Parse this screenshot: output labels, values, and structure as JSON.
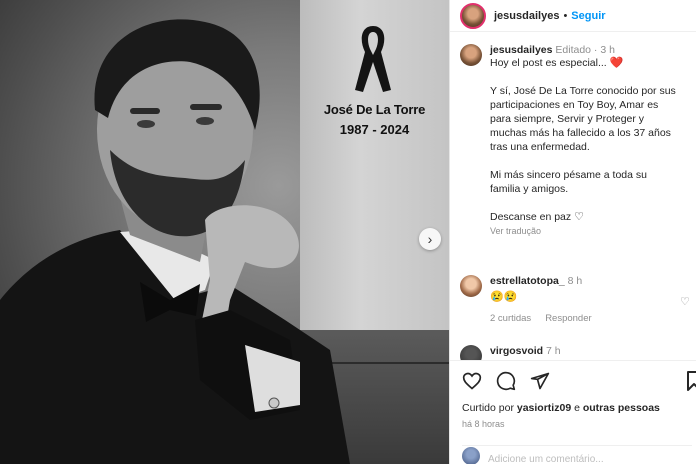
{
  "memorial": {
    "name": "José De La Torre",
    "years": "1987 - 2024"
  },
  "header": {
    "username": "jesusdailyes",
    "separator": "•",
    "follow_label": "Seguir"
  },
  "caption": {
    "username": "jesusdailyes",
    "meta": "Editado · 3 h",
    "lines": [
      "Hoy el post es especial...",
      "Y sí, José De La Torre conocido por sus",
      "participaciones en Toy Boy, Amar es",
      "para siempre, Servir y Proteger y",
      "muchas más ha fallecido a los 37 años",
      "tras una enfermedad.",
      "Mi más sincero pésame a toda su",
      "familia y amigos.",
      "Descanse en paz"
    ],
    "heart_emoji": "❤️",
    "translate_label": "Ver tradução"
  },
  "comments": [
    {
      "username": "estrellatotopa_",
      "meta": "8 h",
      "text": "😢😢",
      "likes_label": "2 curtidas",
      "reply_label": "Responder"
    },
    {
      "username": "virgosvoid",
      "meta": "7 h"
    }
  ],
  "footer": {
    "liked_prefix": "Curtido por",
    "liked_user": "yasiortiz09",
    "liked_suffix": "e",
    "liked_others": "outras pessoas",
    "time_label": "há 8 horas",
    "add_comment_placeholder": "Adicione um comentário..."
  },
  "icons": {
    "like": "heart-icon",
    "comment": "comment-icon",
    "share": "share-icon",
    "save": "bookmark-icon",
    "carousel": "chevron-right-icon",
    "ribbon": "mourning-ribbon-icon"
  }
}
